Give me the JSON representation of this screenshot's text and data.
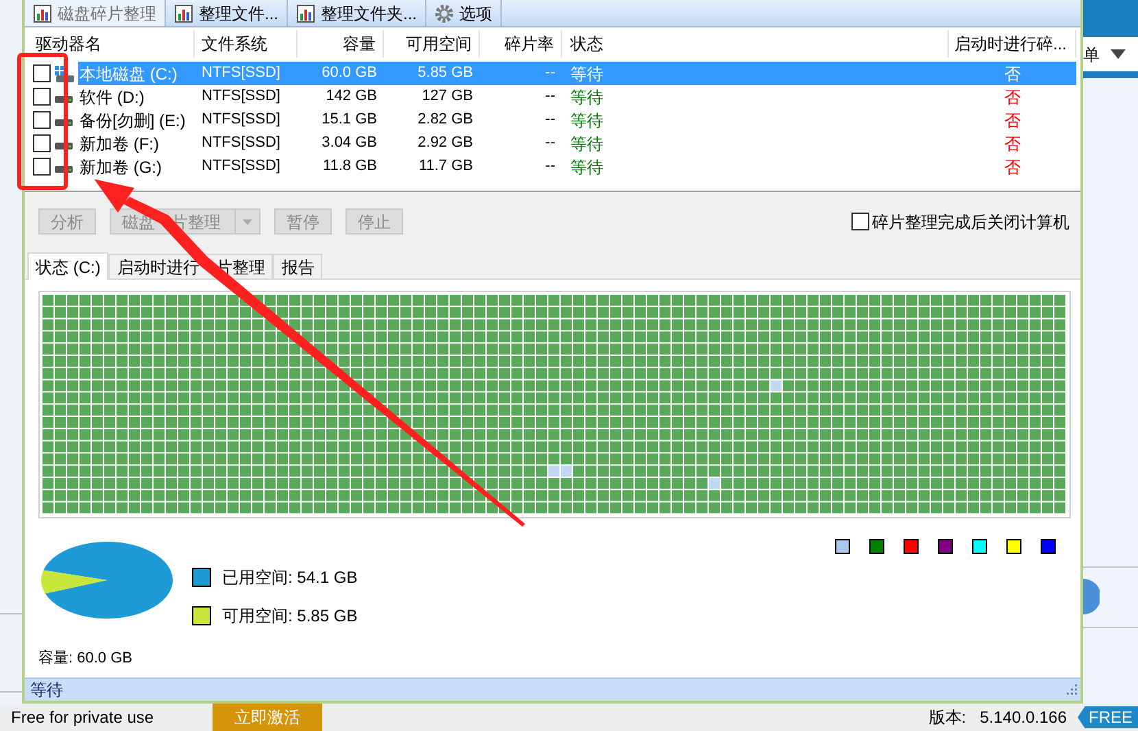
{
  "toolbar": [
    {
      "label": "磁盘碎片整理",
      "selected": true
    },
    {
      "label": "整理文件...",
      "selected": false
    },
    {
      "label": "整理文件夹...",
      "selected": false
    },
    {
      "label": "选项",
      "selected": false
    }
  ],
  "drives": {
    "columns": [
      "驱动器名",
      "文件系统",
      "容量",
      "可用空间",
      "碎片率",
      "状态",
      "启动时进行碎..."
    ],
    "rows": [
      {
        "checked": false,
        "selected": true,
        "kind": "system",
        "name": "本地磁盘 (C:)",
        "filesystem": "NTFS[SSD]",
        "capacity": "60.0 GB",
        "free": "5.85 GB",
        "fragmentation": "--",
        "status": "等待",
        "boot_defrag": "否"
      },
      {
        "checked": false,
        "selected": false,
        "kind": "disk",
        "name": "软件 (D:)",
        "filesystem": "NTFS[SSD]",
        "capacity": "142 GB",
        "free": "127 GB",
        "fragmentation": "--",
        "status": "等待",
        "boot_defrag": "否"
      },
      {
        "checked": false,
        "selected": false,
        "kind": "disk",
        "name": "备份[勿删] (E:)",
        "filesystem": "NTFS[SSD]",
        "capacity": "15.1 GB",
        "free": "2.82 GB",
        "fragmentation": "--",
        "status": "等待",
        "boot_defrag": "否"
      },
      {
        "checked": false,
        "selected": false,
        "kind": "disk",
        "name": "新加卷 (F:)",
        "filesystem": "NTFS[SSD]",
        "capacity": "3.04 GB",
        "free": "2.92 GB",
        "fragmentation": "--",
        "status": "等待",
        "boot_defrag": "否"
      },
      {
        "checked": false,
        "selected": false,
        "kind": "disk",
        "name": "新加卷 (G:)",
        "filesystem": "NTFS[SSD]",
        "capacity": "11.8 GB",
        "free": "11.7 GB",
        "fragmentation": "--",
        "status": "等待",
        "boot_defrag": "否"
      }
    ]
  },
  "actions": [
    {
      "label": "分析",
      "disabled": true,
      "kind": "plain"
    },
    {
      "label": "磁盘　片整理",
      "disabled": true,
      "kind": "split"
    },
    {
      "label": "暂停",
      "disabled": true,
      "kind": "plain"
    },
    {
      "label": "停止",
      "disabled": true,
      "kind": "plain"
    }
  ],
  "shutdown_option": {
    "label": "碎片整理完成后关闭计算机",
    "checked": false
  },
  "tabs": [
    {
      "label": "状态 (C:)",
      "selected": true
    },
    {
      "label": "启动时进行　片整理",
      "selected": false
    },
    {
      "label": "报告",
      "selected": false
    }
  ],
  "map_legend": [
    {
      "color": "#a8c8f0"
    },
    {
      "color": "#008000"
    },
    {
      "color": "#ff0000"
    },
    {
      "color": "#800080"
    },
    {
      "color": "#00ffff"
    },
    {
      "color": "#ffff00"
    },
    {
      "color": "#0000ff"
    }
  ],
  "usage": {
    "legend": [
      {
        "label": "已用空间: 54.1 GB",
        "color": "#1e9bd7"
      },
      {
        "label": "可用空间: 5.85 GB",
        "color": "#c8e63c"
      }
    ],
    "capacity": "容量: 60.0 GB"
  },
  "status_bar": {
    "text": "等待"
  },
  "background_app": {
    "menu_label": "单"
  },
  "footer": {
    "license": "Free for private use",
    "activate_button": "立即激活",
    "version_label": "版本:",
    "version": "5.140.0.166",
    "badge": "FREE"
  }
}
